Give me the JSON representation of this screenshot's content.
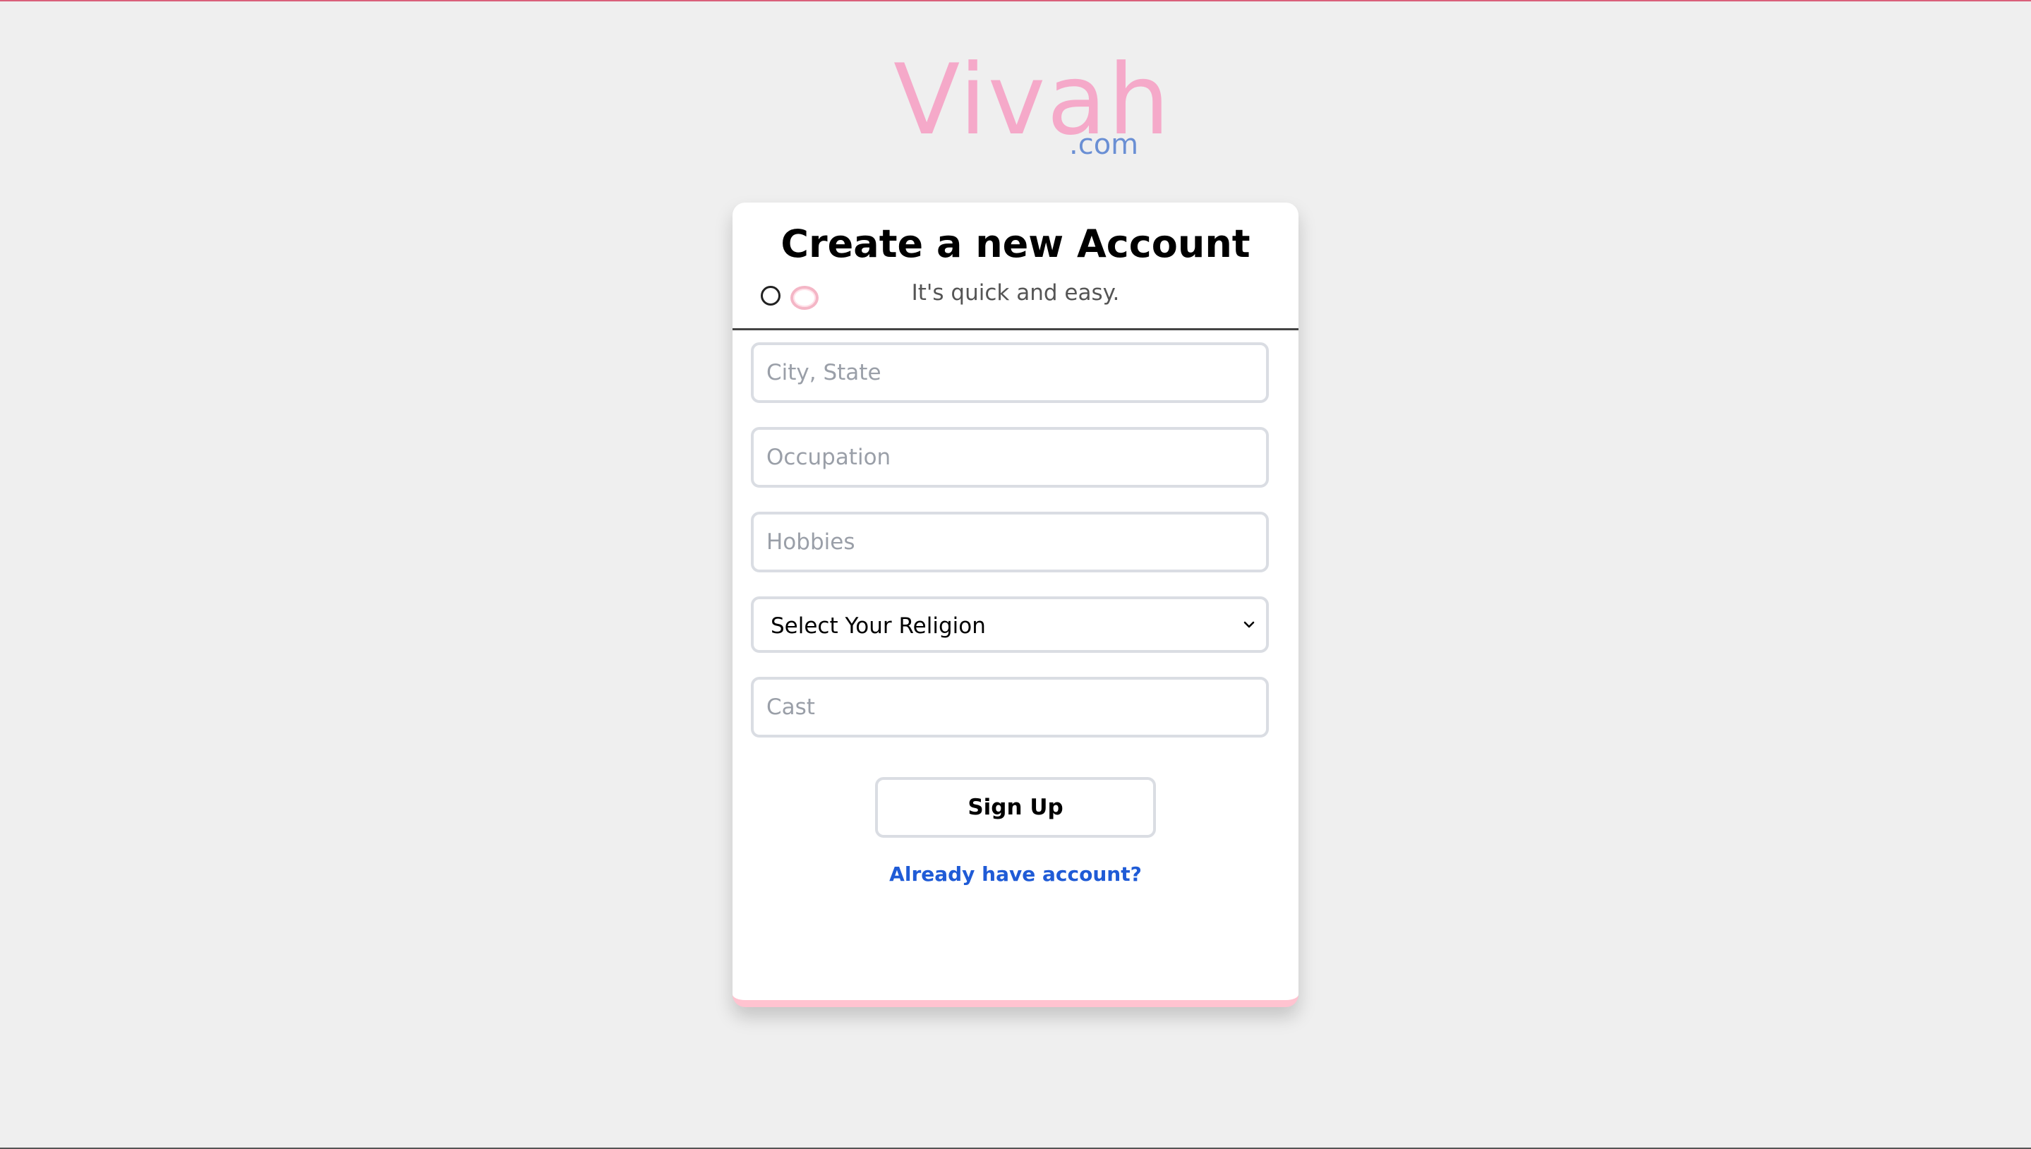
{
  "logo": {
    "name": "Vivah",
    "tld": ".com"
  },
  "form": {
    "title": "Create a new Account",
    "subtitle": "It's quick and easy.",
    "fields": {
      "city_placeholder": "City, State",
      "occupation_placeholder": "Occupation",
      "hobbies_placeholder": "Hobbies",
      "religion_selected": "Select Your Religion",
      "cast_placeholder": "Cast"
    },
    "signup_label": "Sign Up",
    "login_link": "Already have account?"
  },
  "colors": {
    "background": "#efefef",
    "logo": "#f5a9c9",
    "tld": "#6a8fd4",
    "link": "#1f5bd6",
    "card_accent": "#ffc3d0"
  },
  "icons": {
    "select_arrow": "chevron-down-icon"
  }
}
